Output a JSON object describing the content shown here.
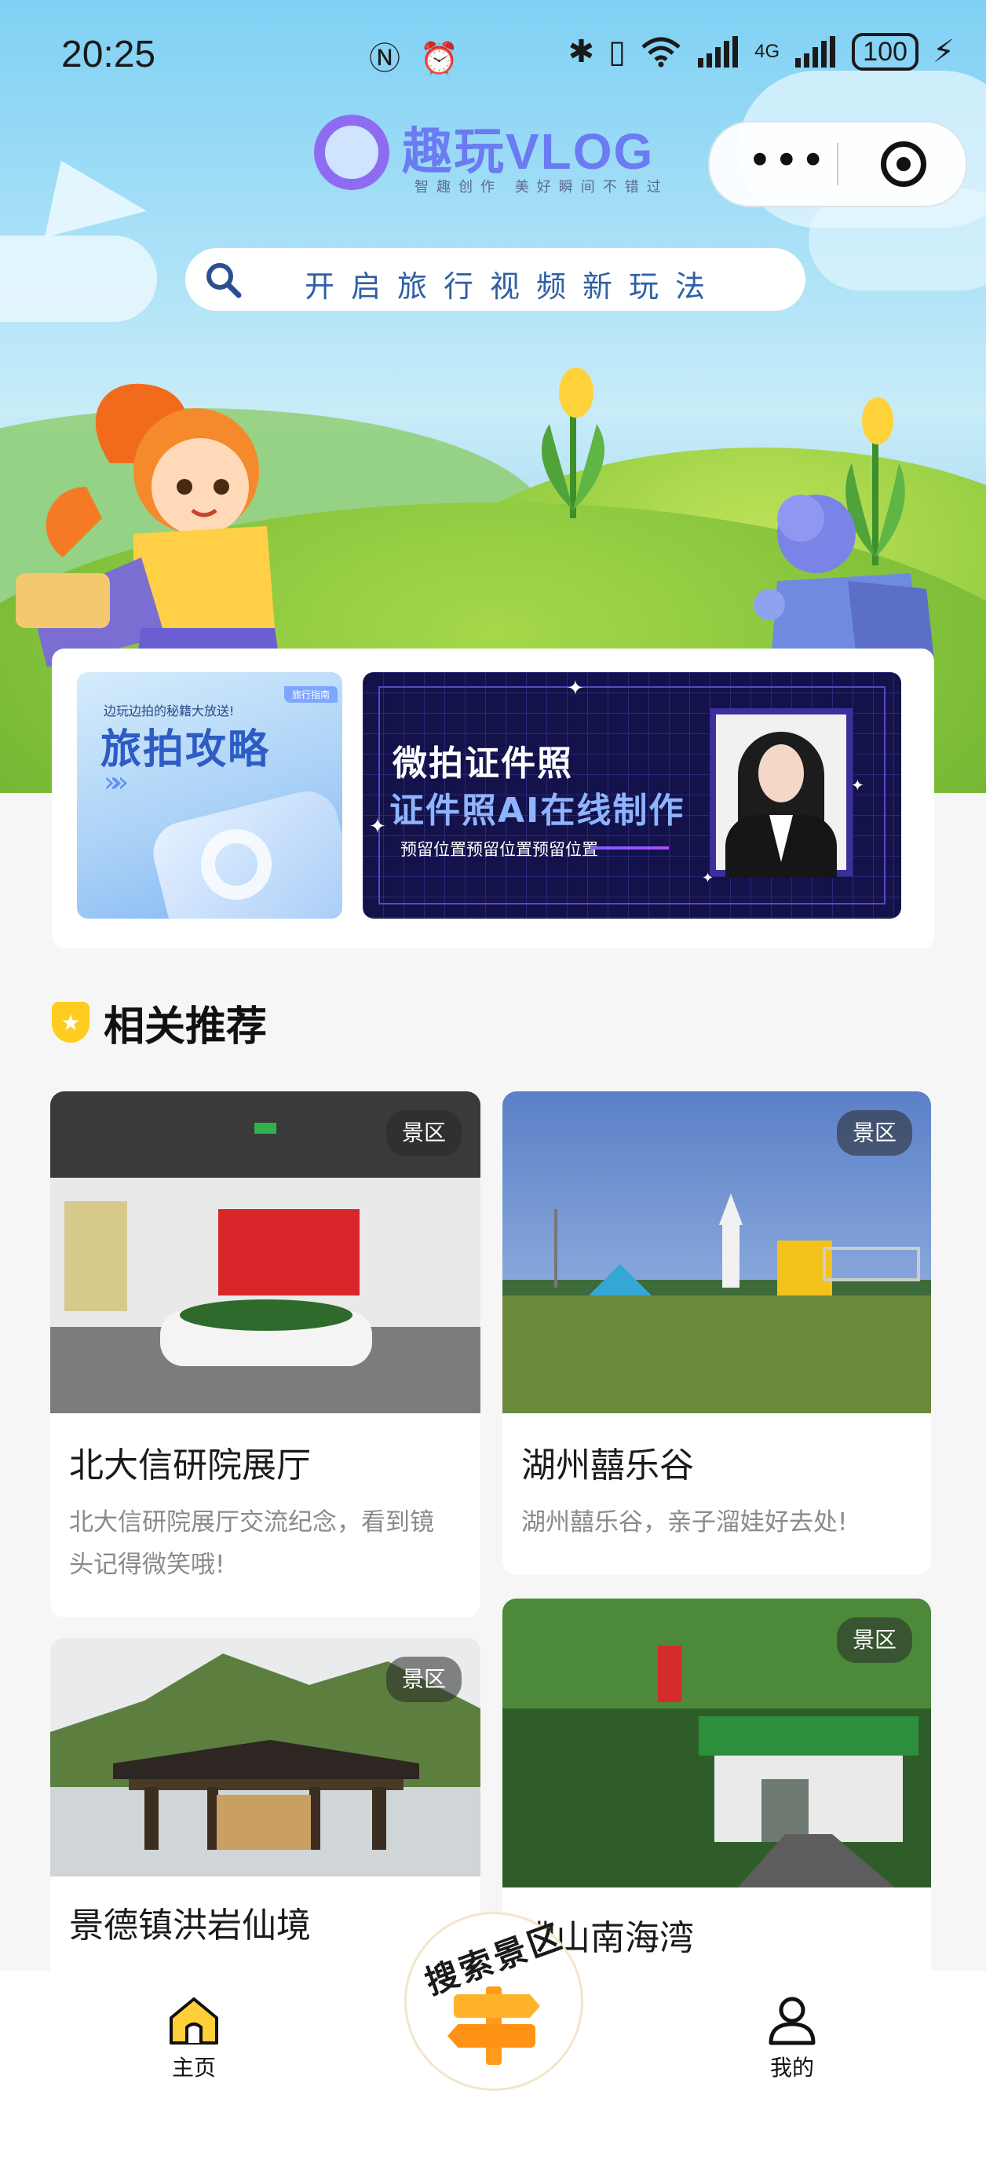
{
  "status_bar": {
    "time": "20:25",
    "network": "4G",
    "battery": "100"
  },
  "header": {
    "logo_title": "趣玩VLOG",
    "logo_subtitle": "智趣创作 美好瞬间不错过",
    "capsule_more": "•••"
  },
  "search": {
    "placeholder": "开启旅行视频新玩法"
  },
  "banners": [
    {
      "tag": "旅行指南",
      "small_text": "边玩边拍的秘籍大放送!",
      "title": "旅拍攻略",
      "chevrons": "»»"
    },
    {
      "title1": "微拍证件照",
      "title2": "证件照AI在线制作",
      "subtitle": "预留位置预留位置预留位置"
    }
  ],
  "section": {
    "title": "相关推荐",
    "badge_icon": "★"
  },
  "items": [
    {
      "name": "北大信研院展厅",
      "tag": "景区",
      "desc": "北大信研院展厅交流纪念，看到镜头记得微笑哦!"
    },
    {
      "name": "湖州囍乐谷",
      "tag": "景区",
      "desc": "湖州囍乐谷，亲子溜娃好去处!"
    },
    {
      "name": "景德镇洪岩仙境",
      "tag": "景区",
      "desc": ""
    },
    {
      "name": "佛山南海湾",
      "tag": "景区",
      "desc": ""
    }
  ],
  "tabbar": {
    "home": "主页",
    "center": "搜索景区",
    "mine": "我的"
  },
  "colors": {
    "accent_yellow": "#ffcc1f",
    "search_text": "#2f5fa6",
    "chip_bg": "rgba(40,40,40,.55)"
  }
}
